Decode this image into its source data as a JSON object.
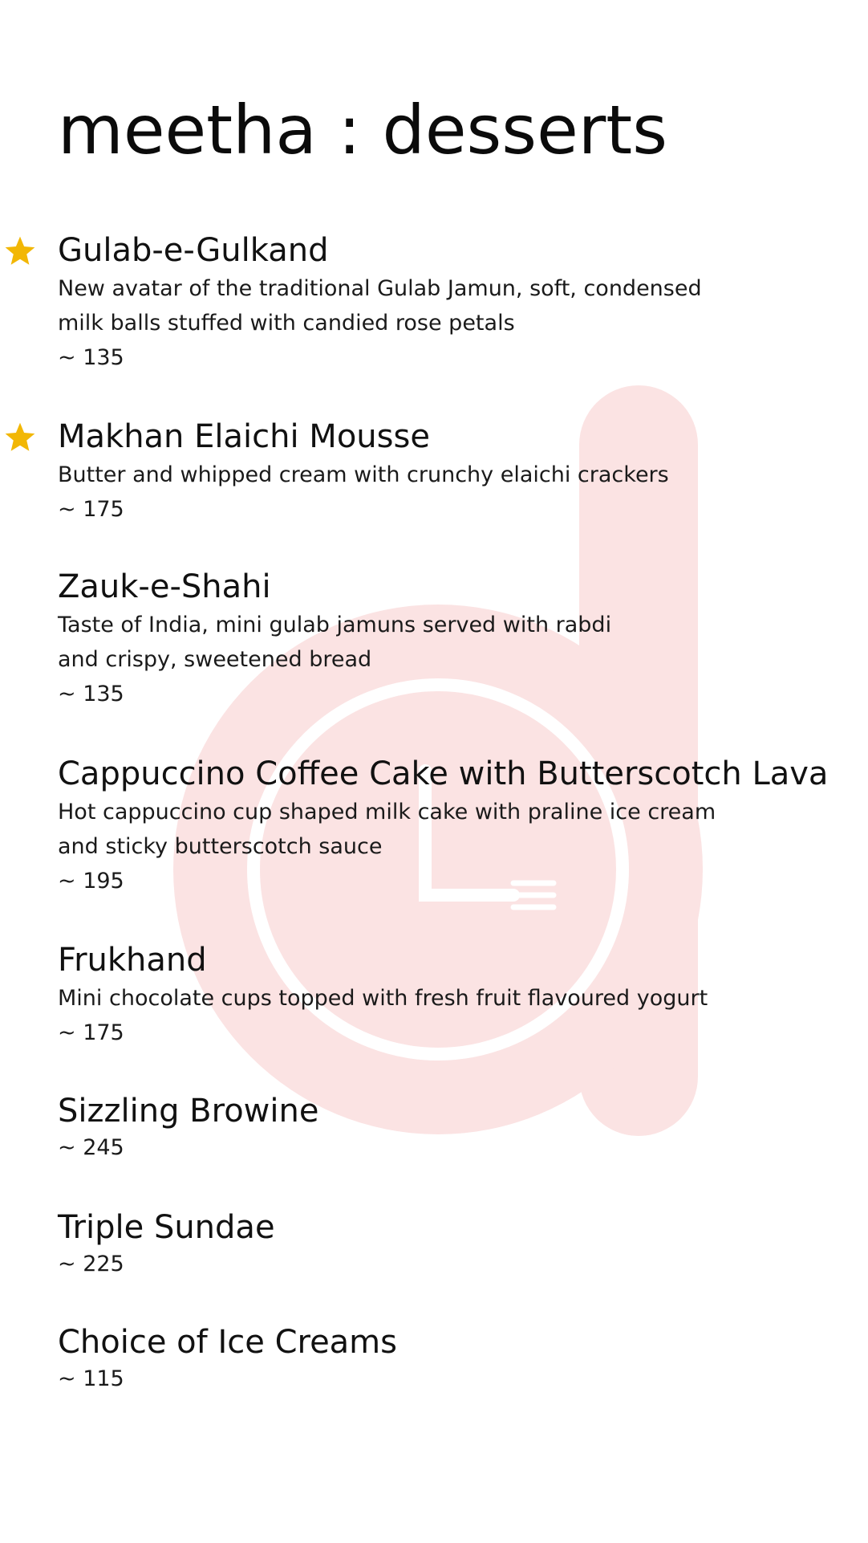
{
  "page": {
    "title": "meetha : desserts"
  },
  "colors": {
    "star": "#F2B705",
    "watermark": "#FBE3E3",
    "text": "#111111"
  },
  "items": [
    {
      "name": "Gulab-e-Gulkand",
      "desc_lines": [
        "New avatar of the traditional Gulab Jamun, soft, condensed",
        "milk balls stuffed with candied rose petals"
      ],
      "price": "~ 135",
      "featured": true
    },
    {
      "name": "Makhan Elaichi Mousse",
      "desc_lines": [
        "Butter and whipped cream with crunchy elaichi crackers"
      ],
      "price": "~ 175",
      "featured": true
    },
    {
      "name": "Zauk-e-Shahi",
      "desc_lines": [
        "Taste of India, mini gulab jamuns served with rabdi",
        "and crispy, sweetened bread"
      ],
      "price": "~ 135",
      "featured": false
    },
    {
      "name": "Cappuccino Coffee Cake with Butterscotch Lava",
      "desc_lines": [
        "Hot cappuccino cup shaped milk cake with praline ice cream",
        "and sticky butterscotch sauce"
      ],
      "price": "~ 195",
      "featured": false
    },
    {
      "name": "Frukhand",
      "desc_lines": [
        "Mini chocolate cups topped with fresh fruit flavoured yogurt"
      ],
      "price": "~ 175",
      "featured": false
    },
    {
      "name": "Sizzling Browine",
      "desc_lines": [],
      "price": "~ 245",
      "featured": false
    },
    {
      "name": "Triple Sundae",
      "desc_lines": [],
      "price": "~ 225",
      "featured": false
    },
    {
      "name": "Choice of Ice Creams",
      "desc_lines": [],
      "price": "~ 115",
      "featured": false
    }
  ]
}
